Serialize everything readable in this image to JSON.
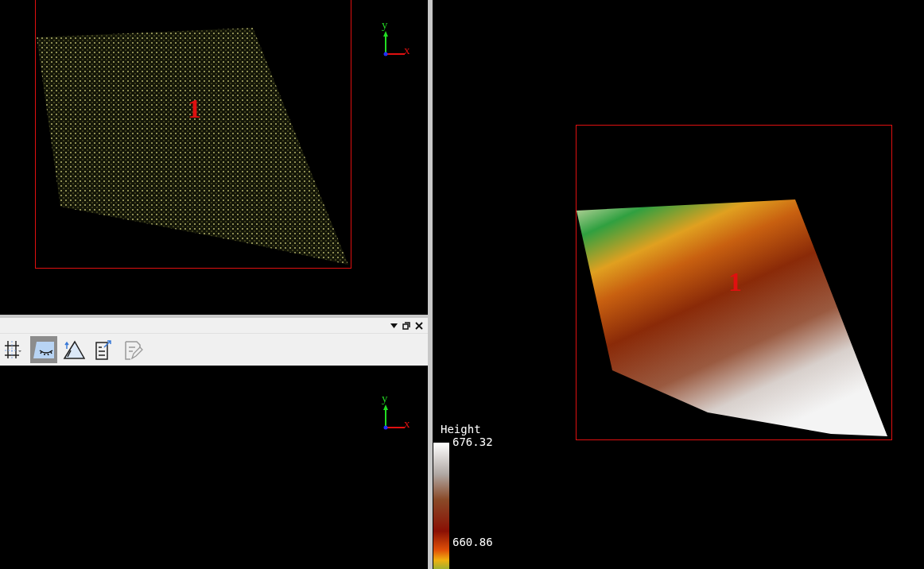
{
  "top_left_view": {
    "object_label": "1",
    "axis": {
      "y": "y",
      "x": "x"
    }
  },
  "dock_panel": {
    "tools": [
      {
        "kind": "grid",
        "selected": false,
        "disabled": false
      },
      {
        "kind": "hide",
        "selected": true,
        "disabled": false
      },
      {
        "kind": "terrain",
        "selected": false,
        "disabled": false
      },
      {
        "kind": "report",
        "selected": false,
        "disabled": false
      },
      {
        "kind": "edit",
        "selected": false,
        "disabled": true
      }
    ]
  },
  "bottom_left_view": {
    "axis": {
      "y": "y",
      "x": "x"
    }
  },
  "right_view": {
    "object_label": "1",
    "legend": {
      "title": "Height",
      "max": "676.32",
      "min": "660.86"
    }
  }
}
